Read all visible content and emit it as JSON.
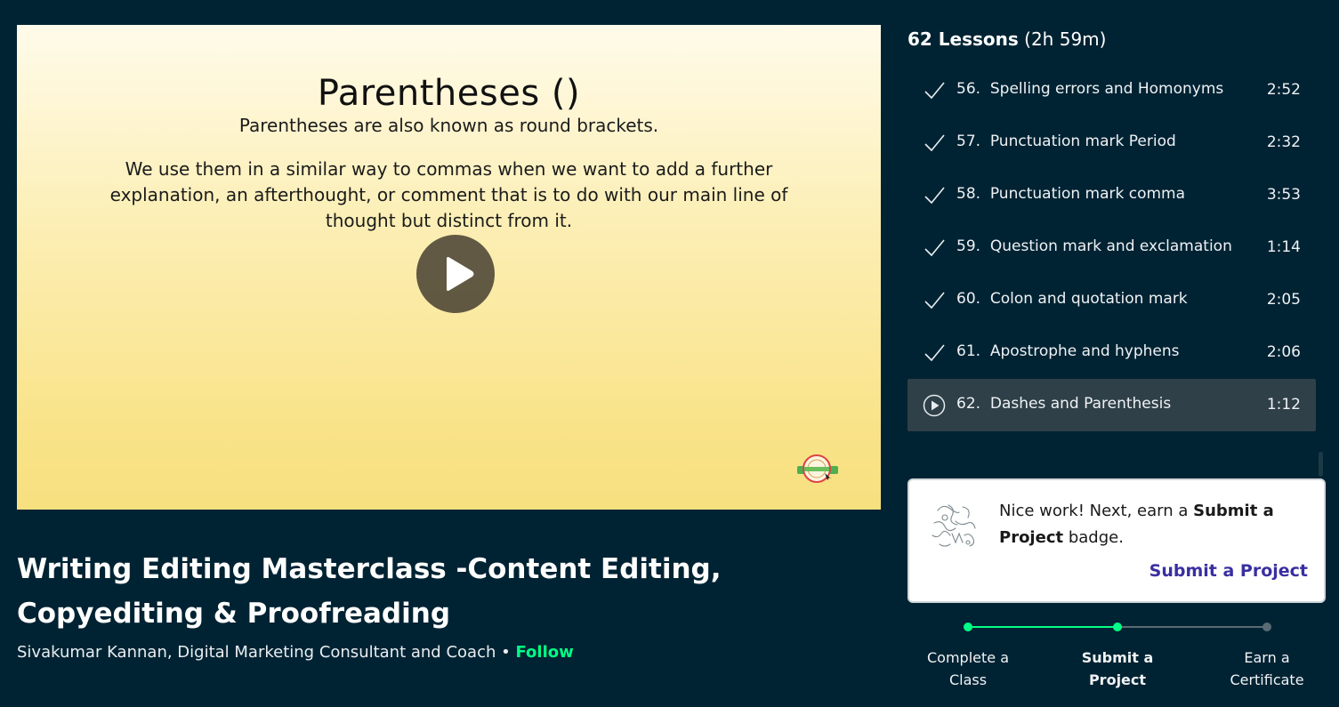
{
  "video": {
    "slide_title": "Parentheses ()",
    "slide_line1": "Parentheses are also known as round brackets.",
    "slide_line2": "We use them in a similar way to commas when we want to add a further explanation, an afterthought, or comment that is to do with our main line of thought but distinct from it.",
    "play_icon": "play-icon",
    "watermark_icon": "badge-logo-icon"
  },
  "class": {
    "title_line1": "Writing Editing Masterclass -Content Editing,",
    "title_line2": "Copyediting & Proofreading",
    "teacher": "Sivakumar Kannan, Digital Marketing Consultant and Coach",
    "separator": "•",
    "follow_label": "Follow"
  },
  "lessons": {
    "count_label": "62 Lessons",
    "duration_label": "(2h 59m)",
    "items": [
      {
        "number": "56.",
        "title": "Spelling errors and Homonyms",
        "duration": "2:52",
        "state": "completed"
      },
      {
        "number": "57.",
        "title": "Punctuation mark Period",
        "duration": "2:32",
        "state": "completed"
      },
      {
        "number": "58.",
        "title": "Punctuation mark comma",
        "duration": "3:53",
        "state": "completed"
      },
      {
        "number": "59.",
        "title": "Question mark and exclamation",
        "duration": "1:14",
        "state": "completed"
      },
      {
        "number": "60.",
        "title": "Colon and quotation mark",
        "duration": "2:05",
        "state": "completed"
      },
      {
        "number": "61.",
        "title": "Apostrophe and hyphens",
        "duration": "2:06",
        "state": "completed"
      },
      {
        "number": "62.",
        "title": "Dashes and Parenthesis",
        "duration": "1:12",
        "state": "playing"
      }
    ]
  },
  "project_card": {
    "msg_prefix": "Nice work! Next, earn a",
    "msg_bold": "Submit a Project",
    "msg_suffix": "badge.",
    "cta_label": "Submit a Project",
    "doodle_icon": "doodle-illustration-icon"
  },
  "progress": {
    "steps": [
      {
        "line1": "Complete a",
        "line2": "Class",
        "state": "done"
      },
      {
        "line1": "Submit a",
        "line2": "Project",
        "state": "current"
      },
      {
        "line1": "Earn a",
        "line2": "Certificate",
        "state": "todo"
      }
    ]
  },
  "colors": {
    "background": "#002333",
    "accent_green": "#00ff84",
    "active_lesson_bg": "#2f4048",
    "cta_purple": "#3a2fa0"
  }
}
